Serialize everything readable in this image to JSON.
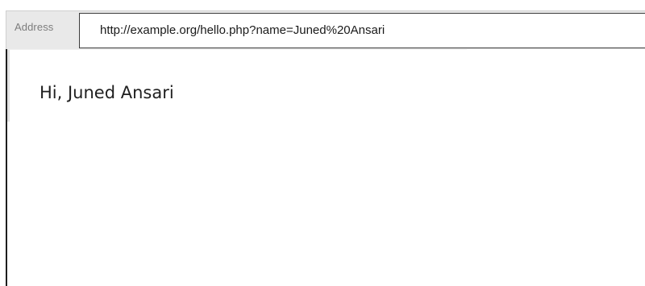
{
  "address_bar": {
    "label": "Address",
    "url": "http://example.org/hello.php?name=Juned%20Ansari"
  },
  "page": {
    "greeting": "Hi, Juned Ansari"
  }
}
